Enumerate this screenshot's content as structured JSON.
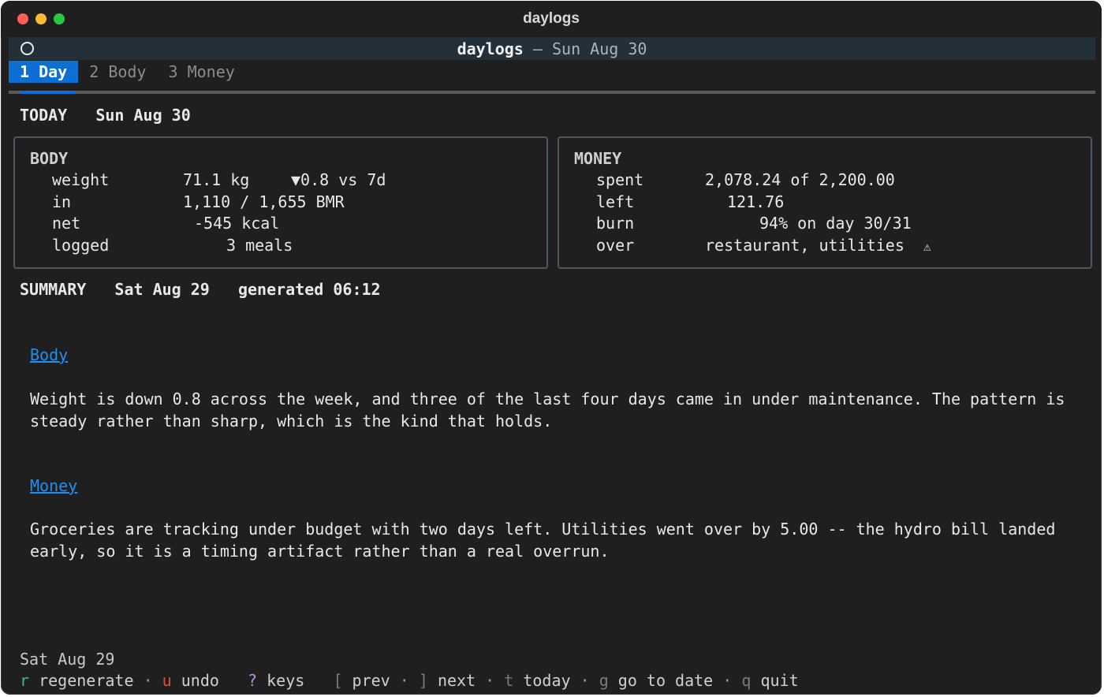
{
  "window": {
    "title": "daylogs"
  },
  "header": {
    "app": "daylogs",
    "separator": "—",
    "date": "Sun Aug 30"
  },
  "tabs": [
    {
      "key": "1",
      "label": "Day",
      "active": true
    },
    {
      "key": "2",
      "label": "Body",
      "active": false
    },
    {
      "key": "3",
      "label": "Money",
      "active": false
    }
  ],
  "today": {
    "label": "TODAY",
    "date": "Sun Aug 30"
  },
  "body_panel": {
    "title": "BODY",
    "rows": [
      {
        "label": "weight",
        "value": "71.1 kg",
        "extra": "▼0.8 vs 7d"
      },
      {
        "label": "in",
        "value": "1,110 / 1,655 BMR",
        "extra": ""
      },
      {
        "label": "net",
        "value": "-545 kcal",
        "extra": ""
      },
      {
        "label": "logged",
        "value": "3 meals",
        "extra": ""
      }
    ]
  },
  "money_panel": {
    "title": "MONEY",
    "rows": [
      {
        "label": "spent",
        "value": "2,078.24 of 2,200.00"
      },
      {
        "label": "left",
        "value": "121.76"
      },
      {
        "label": "burn",
        "value": "94% on day 30/31"
      },
      {
        "label": "over",
        "value": "restaurant, utilities",
        "warning": "⚠"
      }
    ]
  },
  "summary": {
    "label": "SUMMARY",
    "date": "Sat Aug 29",
    "generated_label": "generated",
    "generated_time": "06:12",
    "sections": [
      {
        "heading": "Body",
        "text": "Weight is down 0.8 across the week, and three of the last four days came in under maintenance. The pattern is steady rather than sharp, which is the kind that holds."
      },
      {
        "heading": "Money",
        "text": "Groceries are tracking under budget with two days left. Utilities went over by 5.00 -- the hydro bill landed early, so it is a timing artifact rather than a real overrun."
      }
    ]
  },
  "footer": {
    "date": "Sat Aug 29",
    "keys": [
      {
        "key": "r",
        "label": "regenerate",
        "color": "#37b6a0"
      },
      {
        "key": "u",
        "label": "undo",
        "color": "#e0503c"
      },
      {
        "key": "?",
        "label": "keys",
        "color": "#b98ee0"
      },
      {
        "key": "[",
        "label": "prev",
        "color": "#7a7a7a"
      },
      {
        "key": "]",
        "label": "next",
        "color": "#7a7a7a"
      },
      {
        "key": "t",
        "label": "today",
        "color": "#7a7a7a"
      },
      {
        "key": "g",
        "label": "go to date",
        "color": "#7a7a7a"
      },
      {
        "key": "q",
        "label": "quit",
        "color": "#7a7a7a"
      }
    ]
  },
  "colors": {
    "background": "#1f1f1f",
    "header_bar": "#243039",
    "accent": "#0d6fd1",
    "link": "#1e8ff0"
  }
}
